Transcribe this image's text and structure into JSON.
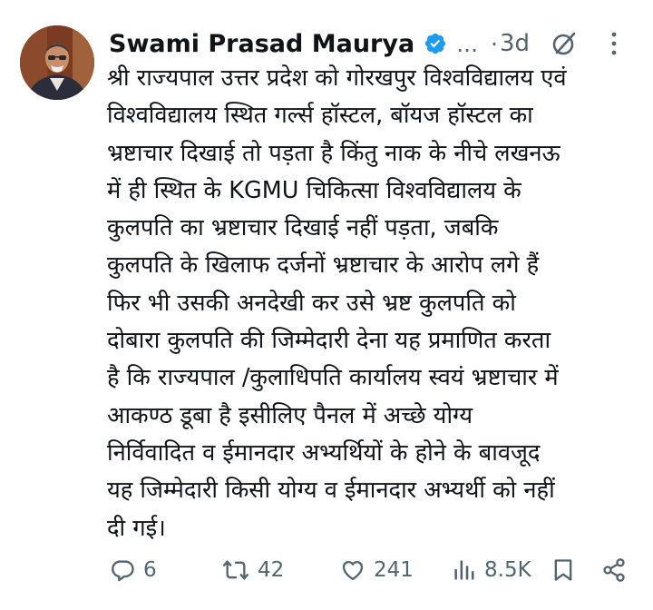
{
  "author": {
    "name": "Swami Prasad Maurya",
    "verified": true,
    "more_handle": "...",
    "time": "3d"
  },
  "body_lines": [
    "श्री राज्यपाल उत्तर प्रदेश को गोरखपुर विश्वविद्यालय एवं",
    "विश्वविद्यालय स्थित गर्ल्स हॉस्टल, बॉयज हॉस्टल का",
    "भ्रष्टाचार दिखाई तो पड़ता है किंतु नाक के नीचे लखनऊ",
    "में ही स्थित के KGMU चिकित्सा विश्वविद्यालय के",
    "कुलपति का भ्रष्टाचार दिखाई नहीं पड़ता, जबकि",
    "कुलपति के खिलाफ दर्जनों भ्रष्टाचार के आरोप लगे हैं",
    "फिर भी  उसकी अनदेखी कर उसे भ्रष्ट कुलपति को",
    "दोबारा कुलपति की जिम्मेदारी देना यह प्रमाणित करता",
    "है कि राज्यपाल /कुलाधिपति कार्यालय स्वयं भ्रष्टाचार में",
    "आकण्ठ डूबा है इसीलिए पैनल में अच्छे योग्य",
    "निर्विवादित व ईमानदार अभ्यर्थियों  के होने के बावजूद",
    "यह जिम्मेदारी  किसी योग्य व ईमानदार अभ्यर्थी को नहीं",
    "दी गई।"
  ],
  "actions": {
    "replies": "6",
    "reposts": "42",
    "likes": "241",
    "views": "8.5K"
  },
  "icons": {
    "verified": "verified-badge-icon",
    "grok": "grok-icon",
    "more": "more-vertical-icon",
    "reply": "reply-icon",
    "repost": "repost-icon",
    "like": "heart-icon",
    "views": "views-chart-icon",
    "bookmark": "bookmark-icon",
    "share": "share-icon"
  },
  "colors": {
    "text": "#0f1419",
    "secondary": "#536471",
    "verified": "#1d9bf0"
  }
}
